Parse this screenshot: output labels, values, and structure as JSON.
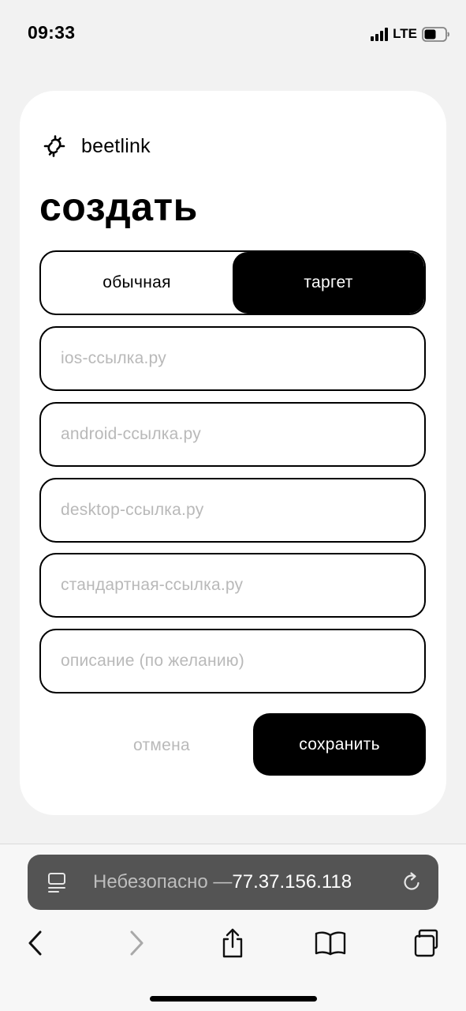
{
  "status_bar": {
    "time": "09:33",
    "network": "LTE"
  },
  "brand": {
    "name": "beetlink",
    "logo_icon": "beetle-link-icon"
  },
  "page": {
    "title": "создать"
  },
  "mode_toggle": {
    "options": [
      "обычная",
      "таргет"
    ],
    "selected": "таргет"
  },
  "form": {
    "fields": [
      {
        "name": "ios",
        "value": "",
        "placeholder": "ios-ссылка.ру"
      },
      {
        "name": "android",
        "value": "",
        "placeholder": "android-ссылка.ру"
      },
      {
        "name": "desktop",
        "value": "",
        "placeholder": "desktop-ссылка.ру"
      },
      {
        "name": "standard",
        "value": "",
        "placeholder": "стандартная-ссылка.ру"
      },
      {
        "name": "description",
        "value": "",
        "placeholder": "описание (по желанию)"
      }
    ],
    "cancel_label": "отмена",
    "save_label": "сохранить"
  },
  "browser": {
    "address_label": "Небезопасно — ",
    "address_host": "77.37.156.118",
    "icons": [
      "reader-icon",
      "reload-icon",
      "back-icon",
      "forward-icon",
      "share-icon",
      "bookmarks-icon",
      "tabs-icon"
    ]
  },
  "colors": {
    "background": "#f2f2f2",
    "card": "#ffffff",
    "accent": "#000000",
    "placeholder": "#b9b9b9",
    "address_bar": "#545454"
  }
}
